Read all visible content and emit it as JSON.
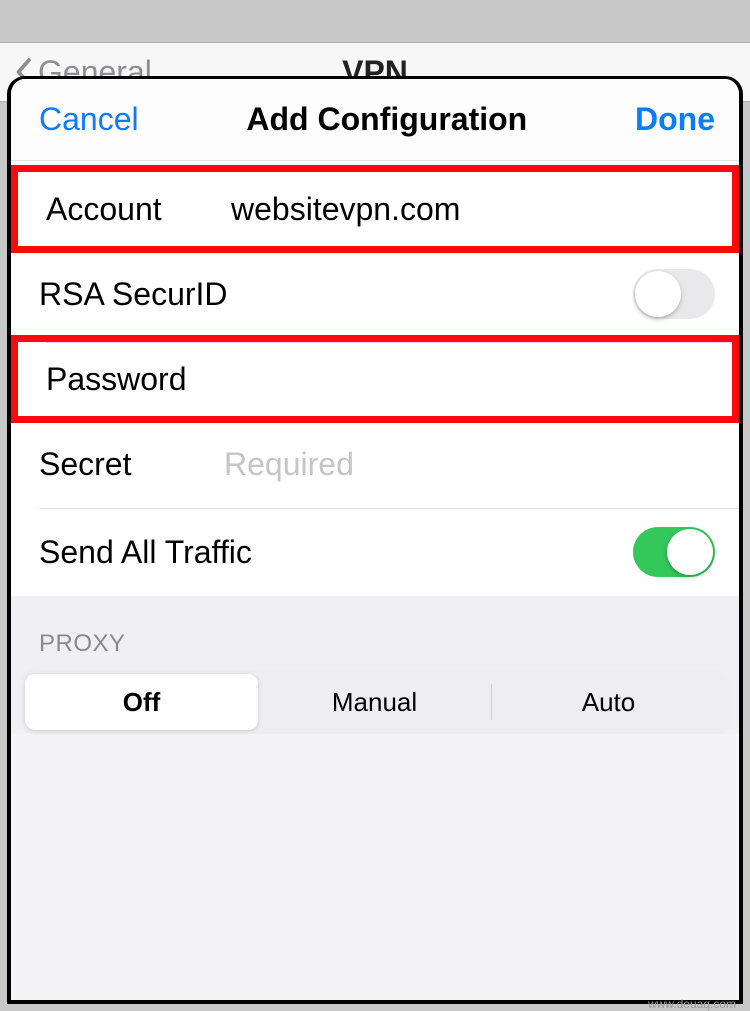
{
  "background": {
    "back_label": "General",
    "title": "VPN"
  },
  "modal": {
    "cancel": "Cancel",
    "title": "Add Configuration",
    "done": "Done"
  },
  "fields": {
    "account": {
      "label": "Account",
      "value": "websitevpn.com"
    },
    "rsa": {
      "label": "RSA SecurID",
      "on": false
    },
    "password": {
      "label": "Password",
      "value": ""
    },
    "secret": {
      "label": "Secret",
      "placeholder": "Required",
      "value": ""
    },
    "send_all": {
      "label": "Send All Traffic",
      "on": true
    }
  },
  "proxy": {
    "header": "PROXY",
    "options": {
      "off": "Off",
      "manual": "Manual",
      "auto": "Auto"
    },
    "selected": "off"
  },
  "watermark": "www.deuaq.com"
}
